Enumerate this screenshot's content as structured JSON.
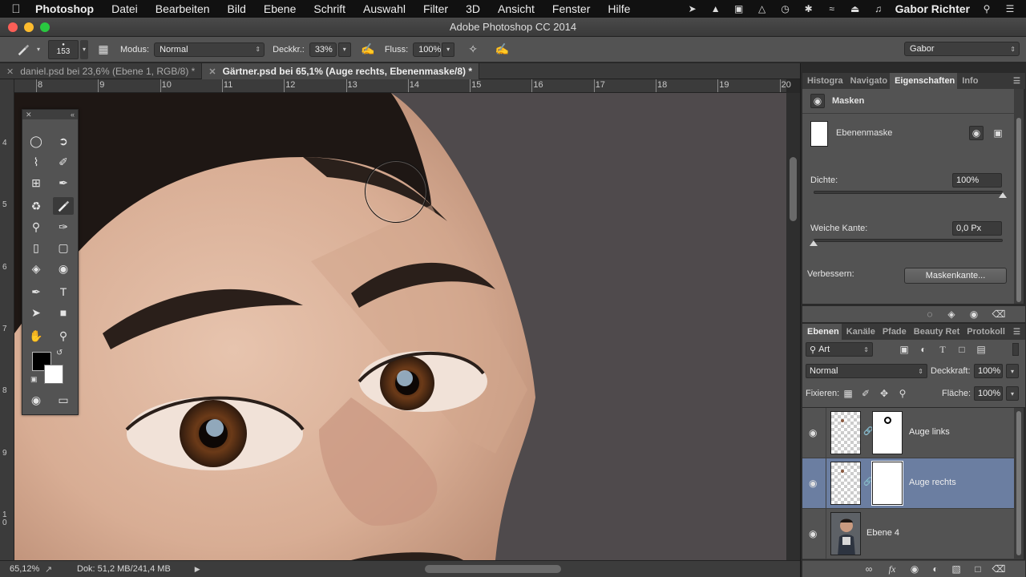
{
  "menubar": {
    "app": "Photoshop",
    "items": [
      "Datei",
      "Bearbeiten",
      "Bild",
      "Ebene",
      "Schrift",
      "Auswahl",
      "Filter",
      "3D",
      "Ansicht",
      "Fenster",
      "Hilfe"
    ],
    "user": "Gabor Richter"
  },
  "window": {
    "title": "Adobe Photoshop CC 2014"
  },
  "options": {
    "brush_size": "153",
    "mode_label": "Modus:",
    "mode_value": "Normal",
    "opacity_label": "Deckkr.:",
    "opacity_value": "33%",
    "flow_label": "Fluss:",
    "flow_value": "100%",
    "workspace": "Gabor"
  },
  "tabs": [
    {
      "label": "daniel.psd bei 23,6% (Ebene 1, RGB/8) *",
      "active": false
    },
    {
      "label": "Gärtner.psd bei 65,1% (Auge rechts, Ebenenmaske/8) *",
      "active": true
    }
  ],
  "ruler": {
    "h": [
      "8",
      "9",
      "10",
      "11",
      "12",
      "13",
      "14",
      "15",
      "16",
      "17",
      "18",
      "19",
      "20"
    ],
    "v": [
      "4",
      "5",
      "6",
      "7",
      "8",
      "9",
      "1\n0"
    ]
  },
  "status": {
    "zoom": "65,12%",
    "doc": "Dok: 51,2 MB/241,4 MB"
  },
  "properties": {
    "tabs": [
      "Histogra",
      "Navigato",
      "Eigenschaften",
      "Info"
    ],
    "active_tab": "Eigenschaften",
    "section": "Masken",
    "mask_type": "Ebenenmaske",
    "density_label": "Dichte:",
    "density_value": "100%",
    "density_level": 1.0,
    "feather_label": "Weiche Kante:",
    "feather_value": "0,0 Px",
    "feather_level": 0.0,
    "refine_label": "Verbessern:",
    "refine_button": "Maskenkante..."
  },
  "layers": {
    "tabs": [
      "Ebenen",
      "Kanäle",
      "Pfade",
      "Beauty Ret",
      "Protokoll"
    ],
    "active_tab": "Ebenen",
    "filter_kind": "Art",
    "blend_mode": "Normal",
    "opacity_label": "Deckkraft:",
    "opacity_value": "100%",
    "lock_label": "Fixieren:",
    "fill_label": "Fläche:",
    "fill_value": "100%",
    "items": [
      {
        "name": "Auge links",
        "selected": false,
        "has_mask": true
      },
      {
        "name": "Auge rechts",
        "selected": true,
        "has_mask": true
      },
      {
        "name": "Ebene 4",
        "selected": false,
        "has_mask": false
      }
    ]
  },
  "colors": {
    "selection": "#6b7ea1",
    "foreground": "#000000",
    "background": "#ffffff"
  }
}
